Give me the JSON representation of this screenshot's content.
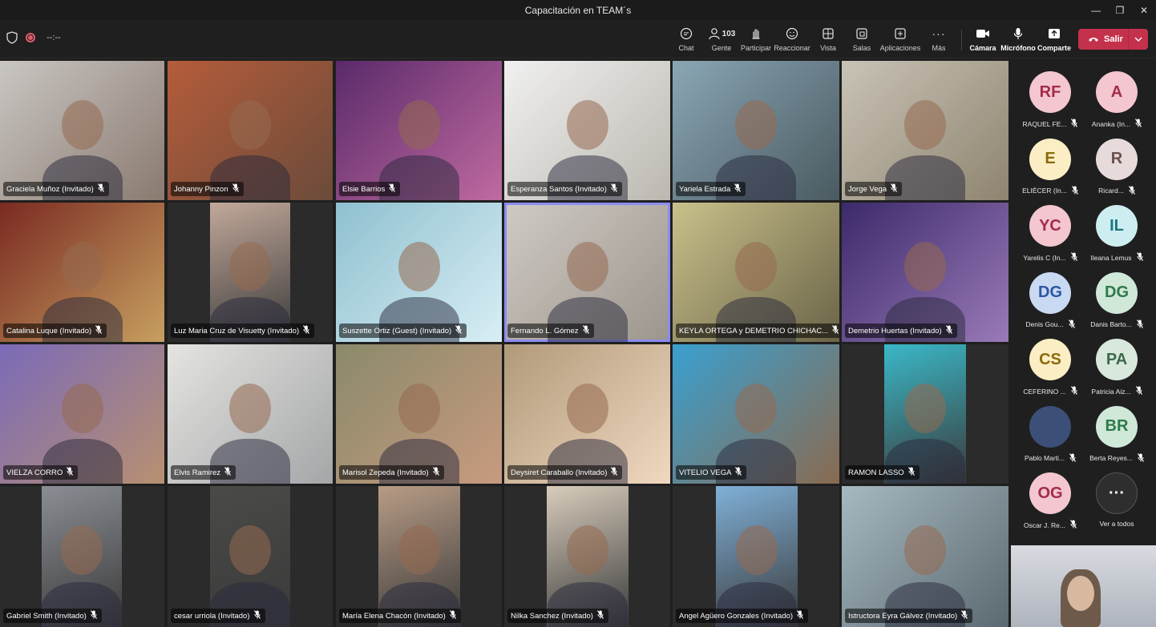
{
  "window": {
    "title": "Capacitación en TEAM´s",
    "controls": [
      "—",
      "❐",
      "✕"
    ]
  },
  "toolbar": {
    "timer": "--:--",
    "buttons": [
      {
        "key": "chat",
        "label": "Chat",
        "icon": "chat-icon"
      },
      {
        "key": "people",
        "label": "Gente",
        "icon": "people-icon",
        "count": "103"
      },
      {
        "key": "raise",
        "label": "Participar",
        "icon": "raise-hand-icon"
      },
      {
        "key": "react",
        "label": "Reaccionar",
        "icon": "emoji-icon"
      },
      {
        "key": "view",
        "label": "Vista",
        "icon": "grid-view-icon"
      },
      {
        "key": "rooms",
        "label": "Salas",
        "icon": "breakout-rooms-icon"
      },
      {
        "key": "apps",
        "label": "Aplicaciones",
        "icon": "add-apps-icon"
      },
      {
        "key": "more",
        "label": "Más",
        "icon": "more-icon"
      },
      {
        "key": "camera",
        "label": "Cámara",
        "icon": "camera-icon"
      },
      {
        "key": "mic",
        "label": "Micrófono",
        "icon": "microphone-icon"
      },
      {
        "key": "share",
        "label": "Comparte",
        "icon": "share-icon"
      }
    ],
    "leave_label": "Salir",
    "leave_color": "#c4314b"
  },
  "participants": [
    "Graciela Muñoz (Invitado)",
    "Johanny Pinzon",
    "Elsie Barrios",
    "Esperanza Santos (Invitado)",
    "Yariela Estrada",
    "Jorge Vega",
    "Catalina Luque (Invitado)",
    "Luz Maria Cruz de Visuetty (Invitado)",
    "Suszette Ortiz (Guest) (Invitado)",
    "Fernando L. Gómez",
    "KEYLA ORTEGA y DEMETRIO CHICHAC...",
    "Demetrio Huertas (Invitado)",
    "VIELZA CORRO",
    "Elvis Ramirez",
    "Marisol Zepeda (Invitado)",
    "Deysiret Caraballo (Invitado)",
    "VITELIO VEGA",
    "RAMON LASSO",
    "Gabriel Smith (Invitado)",
    "cesar urriola (Invitado)",
    "María Elena Chacón (Invitado)",
    "Nilka Sanchez (Invitado)",
    "Angel Agüero Gonzales (Invitado)",
    "Istructora Eyra Gálvez (Invitado)"
  ],
  "sidebar": [
    {
      "initials": "RF",
      "name": "RAQUEL FE...",
      "bg": "#f3c6d0",
      "fg": "#a12d4a"
    },
    {
      "initials": "A",
      "name": "Ananka (In...",
      "bg": "#f3c6d0",
      "fg": "#a12d4a"
    },
    {
      "initials": "E",
      "name": "ELIÉCER (In...",
      "bg": "#fbeec4",
      "fg": "#8a6a0d"
    },
    {
      "initials": "R",
      "name": "Ricard...",
      "bg": "#e6dada",
      "fg": "#6b4e4e"
    },
    {
      "initials": "YC",
      "name": "Yarelis C (In...",
      "bg": "#f3c6d0",
      "fg": "#a12d4a"
    },
    {
      "initials": "IL",
      "name": "Ileana Lemus",
      "bg": "#cdeef0",
      "fg": "#1d7680"
    },
    {
      "initials": "DG",
      "name": "Denis Gou...",
      "bg": "#c9d9f2",
      "fg": "#2b57a3"
    },
    {
      "initials": "DG",
      "name": "Danis Barto...",
      "bg": "#cfe8d8",
      "fg": "#2d7a4a"
    },
    {
      "initials": "CS",
      "name": "CEFERINO ...",
      "bg": "#fbeec4",
      "fg": "#8a6a0d"
    },
    {
      "initials": "PA",
      "name": "Patricia Aiz...",
      "bg": "#d8e8dd",
      "fg": "#3a6a4a"
    },
    {
      "initials": "",
      "name": "Pablo Marti...",
      "bg": "#3b4f78",
      "fg": "#fff"
    },
    {
      "initials": "BR",
      "name": "Berta Reyes...",
      "bg": "#cfe8d8",
      "fg": "#2d7a4a"
    },
    {
      "initials": "OG",
      "name": "Oscar J. Re...",
      "bg": "#f3c6d0",
      "fg": "#a12d4a"
    },
    {
      "initials": "···",
      "name": "Ver a todos",
      "bg": "#2e2e2e",
      "fg": "#fff"
    }
  ]
}
